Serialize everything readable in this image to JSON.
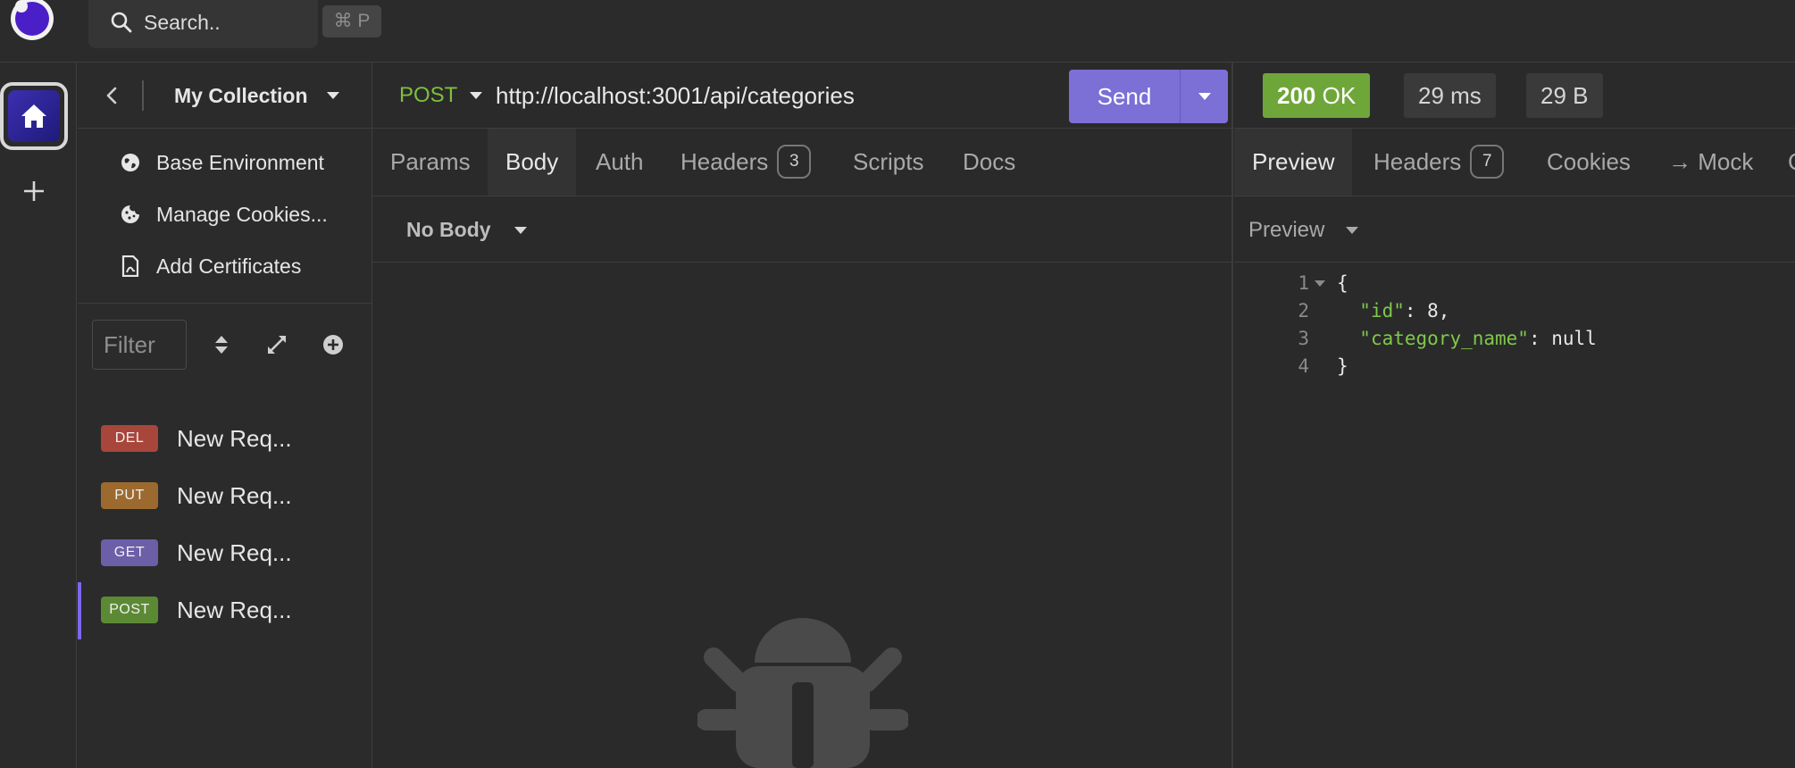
{
  "search": {
    "placeholder_text": "Search..",
    "shortcut": "⌘ P"
  },
  "sidebar": {
    "collection_name": "My Collection",
    "menu": [
      {
        "label": "Base Environment",
        "icon": "globe-icon"
      },
      {
        "label": "Manage Cookies...",
        "icon": "cookie-icon"
      },
      {
        "label": "Add Certificates",
        "icon": "certificate-icon"
      }
    ],
    "filter_placeholder": "Filter",
    "requests": [
      {
        "method": "DEL",
        "name": "New Req...",
        "color": "#a8463b"
      },
      {
        "method": "PUT",
        "name": "New Req...",
        "color": "#9c6a2f"
      },
      {
        "method": "GET",
        "name": "New Req...",
        "color": "#6c5fa8"
      },
      {
        "method": "POST",
        "name": "New Req...",
        "color": "#5c8a34",
        "active": true
      }
    ]
  },
  "request": {
    "method": "POST",
    "url": "http://localhost:3001/api/categories",
    "send_label": "Send",
    "tabs": [
      {
        "label": "Params"
      },
      {
        "label": "Body",
        "active": true
      },
      {
        "label": "Auth"
      },
      {
        "label": "Headers",
        "count": "3"
      },
      {
        "label": "Scripts"
      },
      {
        "label": "Docs"
      }
    ],
    "body_type": "No Body"
  },
  "response": {
    "status_code": "200",
    "status_text": "OK",
    "time": "29 ms",
    "size": "29 B",
    "tabs": [
      {
        "label": "Preview",
        "active": true
      },
      {
        "label": "Headers",
        "count": "7"
      },
      {
        "label": "Cookies"
      },
      {
        "label": "→ Mock"
      },
      {
        "label": "C"
      }
    ],
    "preview_mode": "Preview",
    "body_lines": [
      {
        "num": "1",
        "pre": "{",
        "key": "",
        "post": ""
      },
      {
        "num": "2",
        "pre": "  ",
        "key": "\"id\"",
        "post": ": 8,"
      },
      {
        "num": "3",
        "pre": "  ",
        "key": "\"category_name\"",
        "post": ": null"
      },
      {
        "num": "4",
        "pre": "}",
        "key": "",
        "post": ""
      }
    ]
  },
  "colors": {
    "accent": "#7c6fd6",
    "success": "#6fa63a",
    "background": "#2a2a2a"
  }
}
